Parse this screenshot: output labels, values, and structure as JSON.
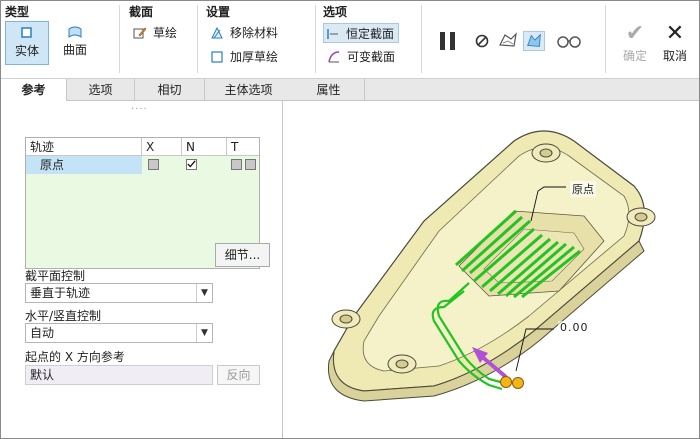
{
  "ribbon": {
    "type_group": {
      "title": "类型",
      "solid": "实体",
      "surface": "曲面"
    },
    "section_group": {
      "title": "截面",
      "sketch": "草绘"
    },
    "settings_group": {
      "title": "设置",
      "remove_material": "移除材料",
      "thicken_sketch": "加厚草绘"
    },
    "options_group": {
      "title": "选项",
      "constant_section": "恒定截面",
      "variable_section": "可变截面"
    },
    "confirm": "确定",
    "cancel": "取消"
  },
  "tabs": [
    "参考",
    "选项",
    "相切",
    "主体选项",
    "属性"
  ],
  "panel": {
    "trajectory_table": {
      "headers": [
        "轨迹",
        "X",
        "N",
        "T"
      ],
      "rows": [
        {
          "name": "原点",
          "x": false,
          "n": true,
          "t": false
        }
      ]
    },
    "details_button": "细节...",
    "section_plane_control_label": "截平面控制",
    "section_plane_control_value": "垂直于轨迹",
    "hv_control_label": "水平/竖直控制",
    "hv_control_value": "自动",
    "x_direction_label": "起点的 X 方向参考",
    "x_direction_value": "默认",
    "reverse_button": "反向"
  },
  "viewport": {
    "annotation_origin": "原点",
    "annotation_coords": "0.00"
  },
  "colors": {
    "part": "#efeab4",
    "part_edge": "#4a4a3a",
    "trajectory": "#22c322",
    "arrow": "#b04fd8",
    "point": "#f3b51a",
    "accent": "#cfe6f7"
  }
}
